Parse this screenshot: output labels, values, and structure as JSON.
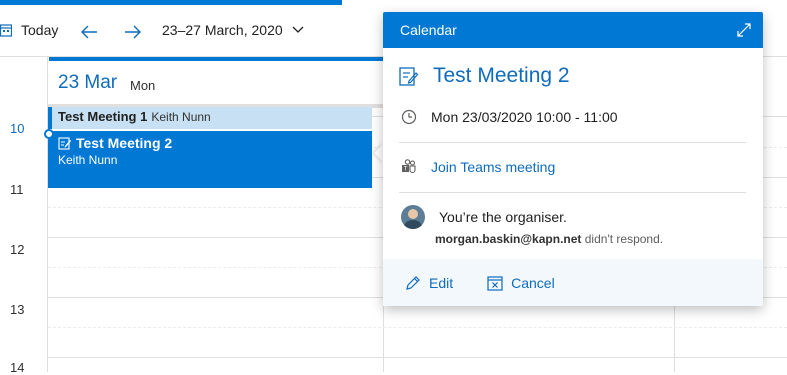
{
  "toolbar": {
    "today_label": "Today",
    "date_range": "23–27 March, 2020"
  },
  "day": {
    "date": "23 Mar",
    "weekday": "Mon"
  },
  "hours": [
    "10",
    "11",
    "12",
    "13",
    "14"
  ],
  "events": [
    {
      "title": "Test Meeting 1",
      "organizer": "Keith Nunn"
    },
    {
      "title": "Test Meeting 2",
      "organizer": "Keith Nunn"
    }
  ],
  "popup": {
    "header": "Calendar",
    "title": "Test Meeting 2",
    "datetime": "Mon 23/03/2020 10:00 - 11:00",
    "join_label": "Join Teams meeting",
    "organiser_text": "You’re the organiser.",
    "attendee_email": "morgan.baskin@kapn.net",
    "attendee_status": "didn't respond.",
    "edit_label": "Edit",
    "cancel_label": "Cancel"
  },
  "colors": {
    "accent": "#0078d4",
    "event_light": "#c7e0f4",
    "link": "#0f6cbd"
  }
}
